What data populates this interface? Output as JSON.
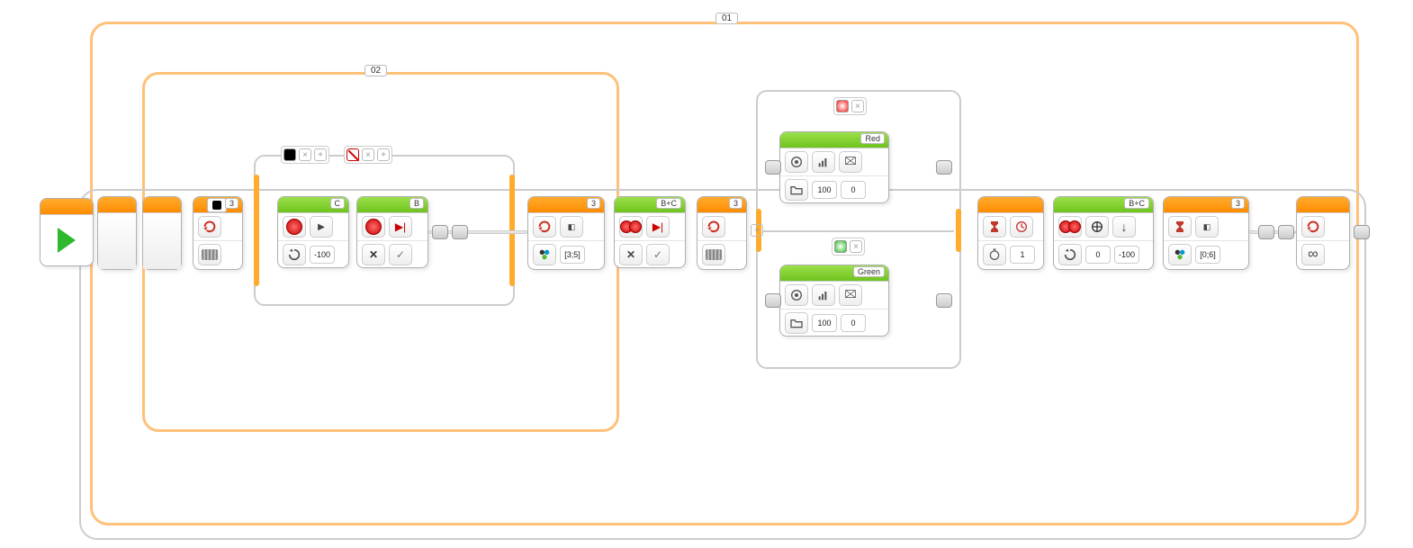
{
  "loops": {
    "outer": {
      "label": "01"
    },
    "inner": {
      "label": "02"
    }
  },
  "start": {
    "name": "start-block"
  },
  "loopInterrupt1": {
    "port": "3",
    "mode_icon": "loop-arrow",
    "sub_icon": "brick-buttons"
  },
  "switch1": {
    "tabs": [
      "black",
      "close",
      "plus",
      "nocolor",
      "close",
      "plus"
    ],
    "case_top": {
      "motorC": {
        "port": "C",
        "mode": "on",
        "power": "-100",
        "rotate_icon": "rotate"
      },
      "motorB": {
        "port": "B",
        "mode": "stop",
        "icons": [
          "x",
          "check"
        ]
      }
    }
  },
  "loopInterrupt2": {
    "port": "3",
    "mode_icon": "loop-arrow",
    "color_mode": "color-sensor",
    "values": "[3;5]"
  },
  "moveSteer1": {
    "port": "B+C",
    "mode": "stop",
    "icons": [
      "x",
      "check"
    ]
  },
  "loopInterrupt3": {
    "port": "3",
    "mode_icon": "loop-arrow",
    "sub_icon": "brick-buttons"
  },
  "switch2": {
    "header_colors": [
      "red-dot",
      "x"
    ],
    "case_red": {
      "label": "Red",
      "sound": {
        "mode": "play-file",
        "volume": "100",
        "play": "0",
        "icons": [
          "speaker",
          "bars",
          "flag",
          "folder"
        ]
      }
    },
    "case_green": {
      "label": "Green",
      "sound": {
        "mode": "play-file",
        "volume": "100",
        "play": "0",
        "icons": [
          "speaker",
          "bars",
          "flag",
          "folder"
        ]
      }
    }
  },
  "wait1": {
    "mode": "time",
    "seconds": "1",
    "icon": "hourglass",
    "sub_icon": "clock"
  },
  "moveSteer2": {
    "port": "B+C",
    "mode": "on",
    "steering": "0",
    "power": "-100",
    "icons": [
      "steering",
      "down",
      "rotate"
    ]
  },
  "waitColor": {
    "port": "3",
    "mode": "color",
    "values": "[0;6]",
    "icon": "hourglass",
    "sub_icon": "color-sensor"
  },
  "loopEnd": {
    "mode": "unlimited",
    "icon": "loop-arrow",
    "infinity": "∞"
  }
}
